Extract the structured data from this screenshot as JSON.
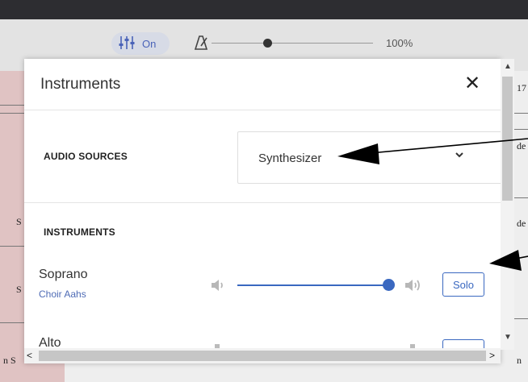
{
  "toolbar": {
    "mixer_toggle_label": "On",
    "tempo_value": "100%",
    "tempo_level": 0.35
  },
  "score_fragments": {
    "right": [
      "17",
      "de",
      "de",
      "n"
    ],
    "left": [
      "S",
      "S",
      "n S"
    ]
  },
  "modal": {
    "title": "Instruments",
    "close_glyph": "✕",
    "audio_sources_label": "AUDIO SOURCES",
    "audio_source_value": "Synthesizer",
    "instruments_label": "INSTRUMENTS",
    "instruments": [
      {
        "name": "Soprano",
        "sound": "Choir Aahs",
        "solo_label": "Solo",
        "volume": 1.0
      },
      {
        "name": "Alto",
        "sound": "",
        "solo_label": "",
        "volume": 1.0
      }
    ]
  },
  "colors": {
    "accent": "#3a68c0",
    "sublabel": "#4e6bb5"
  },
  "icons": {
    "mixer": "mixer-sliders-icon",
    "metronome": "metronome-icon",
    "volume_low": "speaker-low-icon",
    "volume_high": "speaker-high-icon",
    "dropdown": "chevron-down-icon",
    "close": "close-icon"
  }
}
